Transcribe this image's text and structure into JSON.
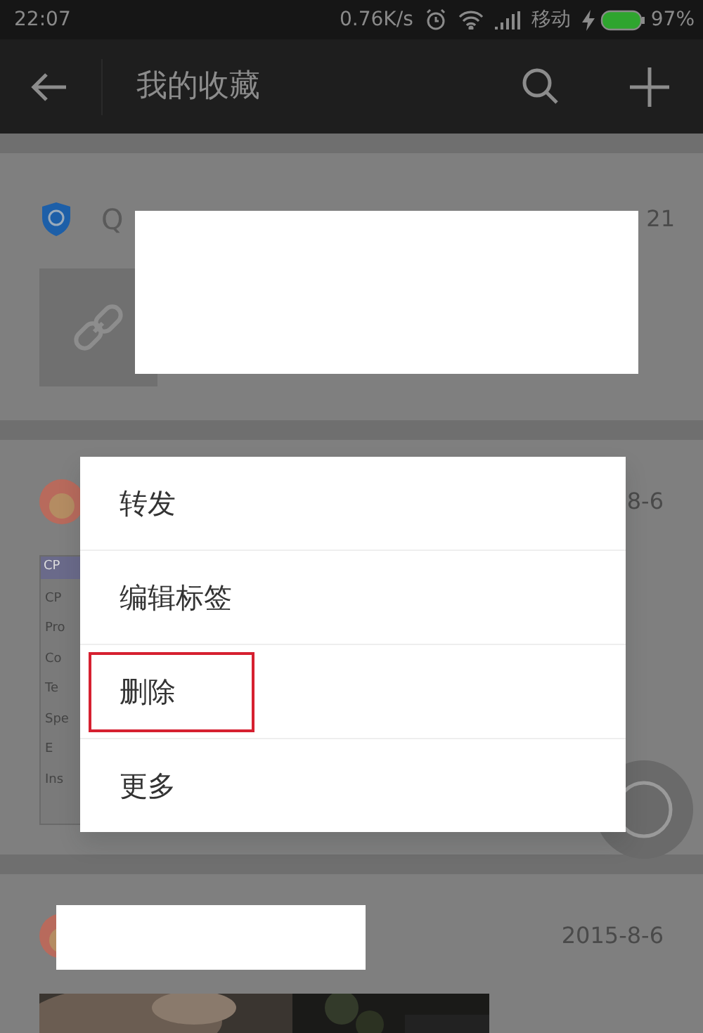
{
  "status_bar": {
    "time": "22:07",
    "speed": "0.76K/s",
    "carrier": "移动",
    "battery": "97%"
  },
  "app_bar": {
    "title": "我的收藏"
  },
  "favorites": [
    {
      "kind": "link",
      "source": "Q",
      "date": "21"
    },
    {
      "kind": "screenshot",
      "date": "8-6",
      "thumb_title": "CP",
      "thumb_lines": [
        "CP",
        "Pro",
        "Co",
        "Te",
        "Spe",
        "E",
        "Ins"
      ]
    },
    {
      "date": "2015-8-6"
    }
  ],
  "context_menu": {
    "items": [
      {
        "label": "转发",
        "highlighted": false
      },
      {
        "label": "编辑标签",
        "highlighted": false
      },
      {
        "label": "删除",
        "highlighted": true
      },
      {
        "label": "更多",
        "highlighted": false
      }
    ]
  }
}
